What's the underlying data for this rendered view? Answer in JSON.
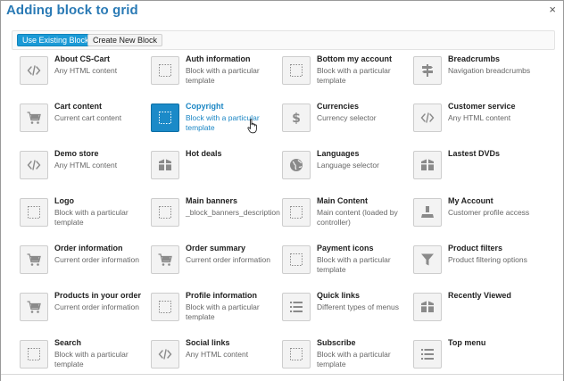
{
  "dialog": {
    "title": "Adding block to grid",
    "close_glyph": "×"
  },
  "tabs": {
    "existing_label": "Use Existing Block",
    "new_label": "Create New Block"
  },
  "blocks": [
    {
      "name": "About CS-Cart",
      "desc": "Any HTML content",
      "icon": "code-icon"
    },
    {
      "name": "Auth information",
      "desc": "Block with a particular template",
      "icon": "template-icon"
    },
    {
      "name": "Bottom my account",
      "desc": "Block with a particular template",
      "icon": "template-icon"
    },
    {
      "name": "Breadcrumbs",
      "desc": "Navigation breadcrumbs",
      "icon": "signpost-icon"
    },
    {
      "name": "Cart content",
      "desc": "Current cart content",
      "icon": "cart-icon"
    },
    {
      "name": "Copyright",
      "desc": "Block with a particular template",
      "icon": "template-icon",
      "active": true
    },
    {
      "name": "Currencies",
      "desc": "Currency selector",
      "icon": "dollar-icon"
    },
    {
      "name": "Customer service",
      "desc": "Any HTML content",
      "icon": "code-icon"
    },
    {
      "name": "Demo store",
      "desc": "Any HTML content",
      "icon": "code-icon"
    },
    {
      "name": "Hot deals",
      "desc": "",
      "icon": "box-icon"
    },
    {
      "name": "Languages",
      "desc": "Language selector",
      "icon": "globe-icon"
    },
    {
      "name": "Lastest DVDs",
      "desc": "",
      "icon": "box-icon"
    },
    {
      "name": "Logo",
      "desc": "Block with a particular template",
      "icon": "template-icon"
    },
    {
      "name": "Main banners",
      "desc": "_block_banners_description",
      "icon": "template-icon"
    },
    {
      "name": "Main Content",
      "desc": "Main content (loaded by controller)",
      "icon": "template-icon"
    },
    {
      "name": "My Account",
      "desc": "Customer profile access",
      "icon": "user-icon"
    },
    {
      "name": "Order information",
      "desc": "Current order information",
      "icon": "cart-icon"
    },
    {
      "name": "Order summary",
      "desc": "Current order information",
      "icon": "cart-icon"
    },
    {
      "name": "Payment icons",
      "desc": "Block with a particular template",
      "icon": "template-icon"
    },
    {
      "name": "Product filters",
      "desc": "Product filtering options",
      "icon": "filter-icon"
    },
    {
      "name": "Products in your order",
      "desc": "Current order information",
      "icon": "cart-icon"
    },
    {
      "name": "Profile information",
      "desc": "Block with a particular template",
      "icon": "template-icon"
    },
    {
      "name": "Quick links",
      "desc": "Different types of menus",
      "icon": "list-icon"
    },
    {
      "name": "Recently Viewed",
      "desc": "",
      "icon": "box-icon"
    },
    {
      "name": "Search",
      "desc": "Block with a particular template",
      "icon": "template-icon"
    },
    {
      "name": "Social links",
      "desc": "Any HTML content",
      "icon": "code-icon"
    },
    {
      "name": "Subscribe",
      "desc": "Block with a particular template",
      "icon": "template-icon"
    },
    {
      "name": "Top menu",
      "desc": "",
      "icon": "list-icon"
    }
  ],
  "colors": {
    "accent": "#1b9ad6",
    "title": "#2a7ab5",
    "icon_gray": "#8a8a8a",
    "icon_active": "#ffffff"
  }
}
